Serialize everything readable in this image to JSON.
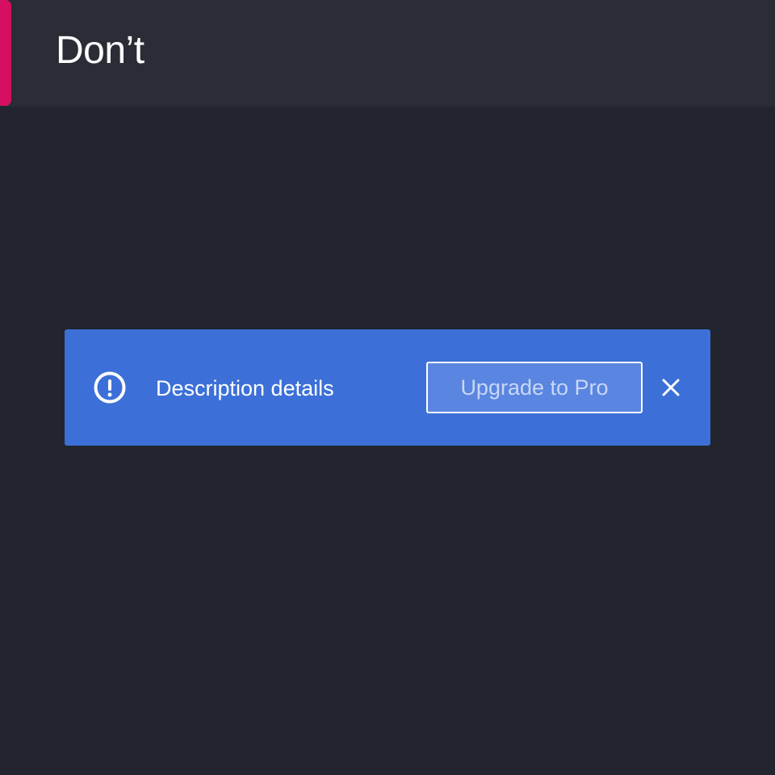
{
  "header": {
    "title": "Don’t",
    "accent_color": "#d50f62"
  },
  "banner": {
    "icon": "info-icon",
    "description": "Description details",
    "button_label": "Upgrade to Pro",
    "close_icon": "close-icon",
    "background_color": "#3c70d8"
  },
  "theme": {
    "background": "#22252e",
    "header_background": "#2a2d36"
  }
}
